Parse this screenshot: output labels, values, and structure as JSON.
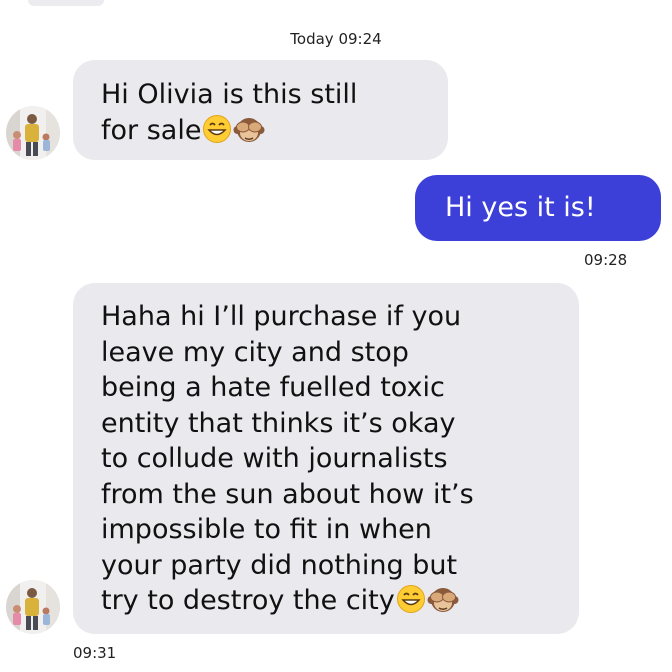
{
  "conversation": {
    "date_header": "Today 09:24",
    "messages": [
      {
        "direction": "incoming",
        "lines": [
          "Hi Olivia is this still",
          "for sale"
        ],
        "emojis": [
          "grinning-face",
          "see-no-evil-monkey"
        ]
      },
      {
        "direction": "outgoing",
        "lines": [
          "Hi yes it is!"
        ],
        "time": "09:28"
      },
      {
        "direction": "incoming",
        "lines": [
          "Haha hi I’ll purchase if you",
          "leave my city and stop",
          "being a hate fuelled toxic",
          "entity that thinks it’s okay",
          "to collude with journalists",
          "from the sun about how it’s",
          "impossible to fit in when",
          "your party did nothing but",
          "try to destroy the city"
        ],
        "emojis": [
          "grinning-face",
          "see-no-evil-monkey"
        ],
        "time": "09:31"
      }
    ]
  },
  "colors": {
    "incoming_bubble": "#e9e9ee",
    "outgoing_bubble": "#3d3fd9",
    "outgoing_text": "#ffffff"
  }
}
